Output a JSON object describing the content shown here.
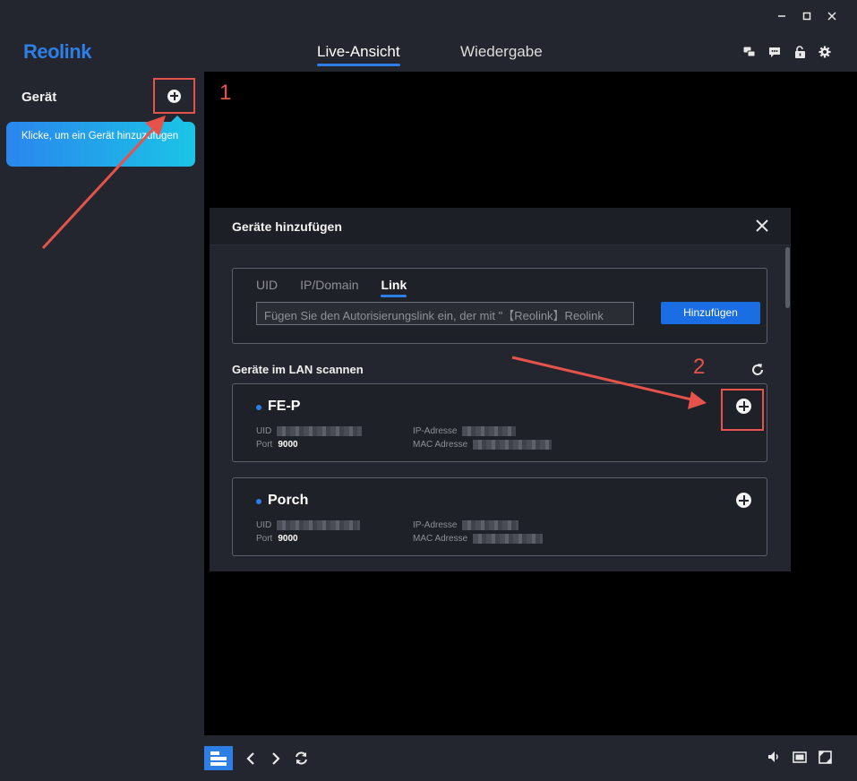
{
  "window": {
    "controls": [
      "minimize-icon",
      "maximize-icon",
      "close-icon"
    ]
  },
  "header": {
    "logo": "Reolink",
    "tabs": [
      {
        "label": "Live-Ansicht",
        "active": true
      },
      {
        "label": "Wiedergabe",
        "active": false
      }
    ],
    "icons": [
      "message-icon",
      "chat-icon",
      "unlock-icon",
      "settings-icon"
    ]
  },
  "sidebar": {
    "title": "Gerät",
    "tooltip": "Klicke, um ein Gerät hinzuzufügen"
  },
  "annotations": {
    "step1": "1",
    "step2": "2",
    "color": "#e5534b"
  },
  "dialog": {
    "title": "Geräte hinzufügen",
    "tabs": [
      {
        "label": "UID",
        "active": false
      },
      {
        "label": "IP/Domain",
        "active": false
      },
      {
        "label": "Link",
        "active": true
      }
    ],
    "link_placeholder": "Fügen Sie den Autorisierungslink ein, der mit \"【Reolink】Reolink",
    "add_button": "Hinzufügen",
    "scan_title": "Geräte im LAN scannen",
    "devices": [
      {
        "name": "FE-P",
        "uid_label": "UID",
        "port_label": "Port",
        "port": "9000",
        "ip_label": "IP-Adresse",
        "mac_label": "MAC Adresse"
      },
      {
        "name": "Porch",
        "uid_label": "UID",
        "port_label": "Port",
        "port": "9000",
        "ip_label": "IP-Adresse",
        "mac_label": "MAC Adresse"
      }
    ]
  },
  "colors": {
    "accent": "#2d7fe6",
    "background": "#23262e",
    "annotation": "#e5534b"
  }
}
